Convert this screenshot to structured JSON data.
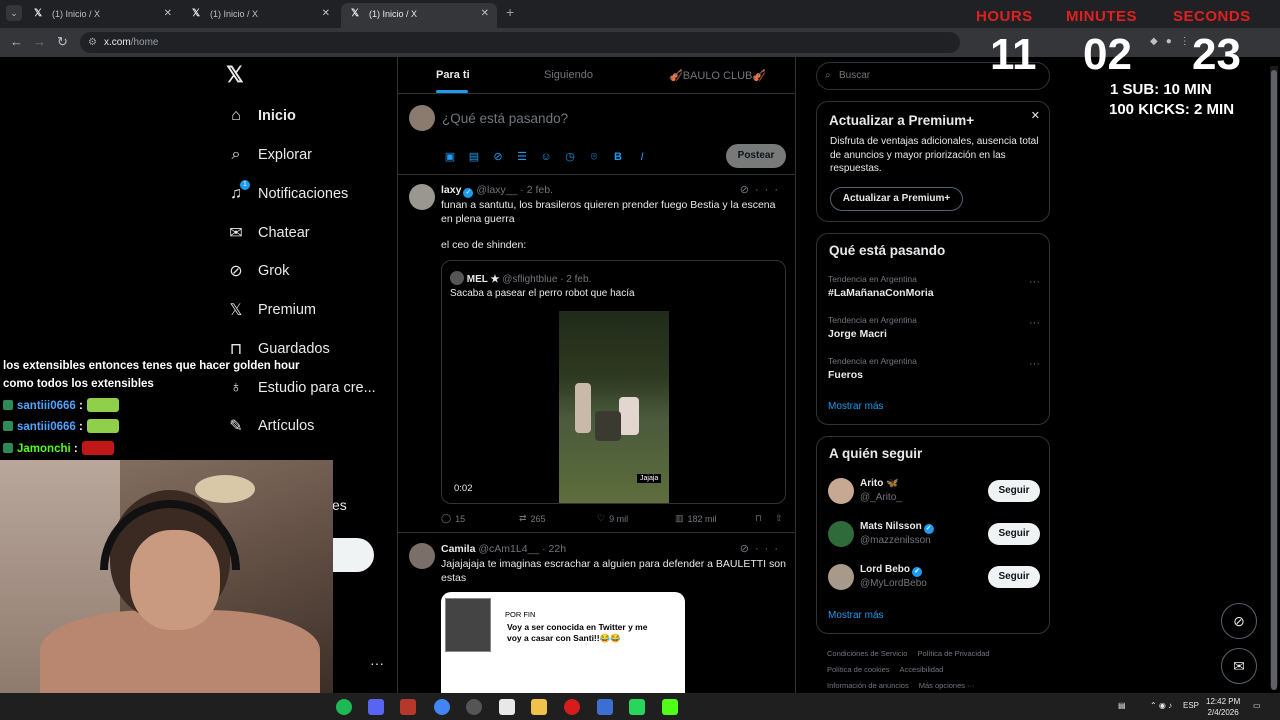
{
  "browser": {
    "tabs": [
      {
        "title": "(1) Inicio / X",
        "active": false
      },
      {
        "title": "(1) Inicio / X",
        "active": false
      },
      {
        "title": "(1) Inicio / X",
        "active": true
      }
    ],
    "url_host": "x.com",
    "url_path": "/home"
  },
  "nav": {
    "items": [
      {
        "label": "Inicio",
        "icon": "home-icon"
      },
      {
        "label": "Explorar",
        "icon": "search-icon"
      },
      {
        "label": "Notificaciones",
        "icon": "bell-icon",
        "badge": "1"
      },
      {
        "label": "Chatear",
        "icon": "mail-icon"
      },
      {
        "label": "Grok",
        "icon": "grok-icon"
      },
      {
        "label": "Premium",
        "icon": "x-logo-icon"
      },
      {
        "label": "Guardados",
        "icon": "bookmark-icon"
      },
      {
        "label": "Estudio para cre...",
        "icon": "creator-studio-icon"
      },
      {
        "label": "Artículos",
        "icon": "articles-icon"
      }
    ],
    "partial_label": "es"
  },
  "feed": {
    "tabs": [
      "Para ti",
      "Siguiendo",
      "🎻BAULO CLUB🎻"
    ],
    "composer_placeholder": "¿Qué está pasando?",
    "post_button": "Postear",
    "tweets": [
      {
        "name": "laxy",
        "handle": "@laxy__",
        "date": "· 2 feb.",
        "text": "funan a santutu, los brasileros quieren prender fuego Bestia y la escena en plena guerra",
        "text2": "el ceo de shinden:",
        "quote": {
          "name": "MEL ★",
          "handle": "@sflightblue",
          "date": "· 2 feb.",
          "text": "Sacaba a pasear el perro robot que hacía",
          "video_time": "0:02",
          "watermark": "Jajaja"
        },
        "replies": "15",
        "reposts": "265",
        "likes": "9 mil",
        "views": "182 mil"
      },
      {
        "name": "Camila",
        "handle": "@cAm1L4__",
        "date": "· 22h",
        "text": "Jajajajaja te imaginas escrachar a alguien para defender a BAULETTI son estas",
        "meme_caption1": "POR FIN",
        "meme_caption2": "Voy a ser conocida en Twitter y me voy a casar con Santi!!😂😂"
      }
    ]
  },
  "sidebar": {
    "search_placeholder": "Buscar",
    "premium": {
      "title": "Actualizar a Premium+",
      "text": "Disfruta de ventajas adicionales, ausencia total de anuncios y mayor priorización en las respuestas.",
      "button": "Actualizar a Premium+"
    },
    "trends": {
      "title": "Qué está pasando",
      "items": [
        {
          "sub": "Tendencia en Argentina",
          "name": "#LaMañanaConMoria"
        },
        {
          "sub": "Tendencia en Argentina",
          "name": "Jorge Macri"
        },
        {
          "sub": "Tendencia en Argentina",
          "name": "Fueros"
        }
      ],
      "more": "Mostrar más"
    },
    "follow": {
      "title": "A quién seguir",
      "items": [
        {
          "name": "Arito 🦋",
          "handle": "@_Arito_",
          "button": "Seguir"
        },
        {
          "name": "Mats Nilsson",
          "handle": "@mazzenilsson",
          "button": "Seguir"
        },
        {
          "name": "Lord Bebo",
          "handle": "@MyLordBebo",
          "button": "Seguir"
        }
      ],
      "more": "Mostrar más"
    },
    "footer": [
      "Condiciones de Servicio",
      "Política de Privacidad",
      "Política de cookies",
      "Accesibilidad",
      "Información de anuncios",
      "Más opciones ···"
    ]
  },
  "overlay": {
    "timer": {
      "hours_label": "HOURS",
      "minutes_label": "MINUTES",
      "seconds_label": "SECONDS",
      "hours": "11",
      "minutes": "02",
      "seconds": "23"
    },
    "rule1": "1 SUB: 10 MIN",
    "rule2": "100 KICKS: 2 MIN",
    "chat": [
      {
        "type": "text",
        "text": "los extensibles entonces tenes que hacer golden hour como todos los extensibles"
      },
      {
        "type": "user",
        "user": "santiii0666",
        "sep": ":"
      },
      {
        "type": "user",
        "user": "santiii0666",
        "sep": ":"
      },
      {
        "type": "user",
        "user": "Jamonchi",
        "sep": ":"
      }
    ]
  },
  "taskbar": {
    "lang": "ESP",
    "time": "12:42 PM",
    "date": "2/4/2026"
  },
  "colors": {
    "accent": "#1d9bf0",
    "timer_label": "#e02020",
    "background": "#000000"
  }
}
